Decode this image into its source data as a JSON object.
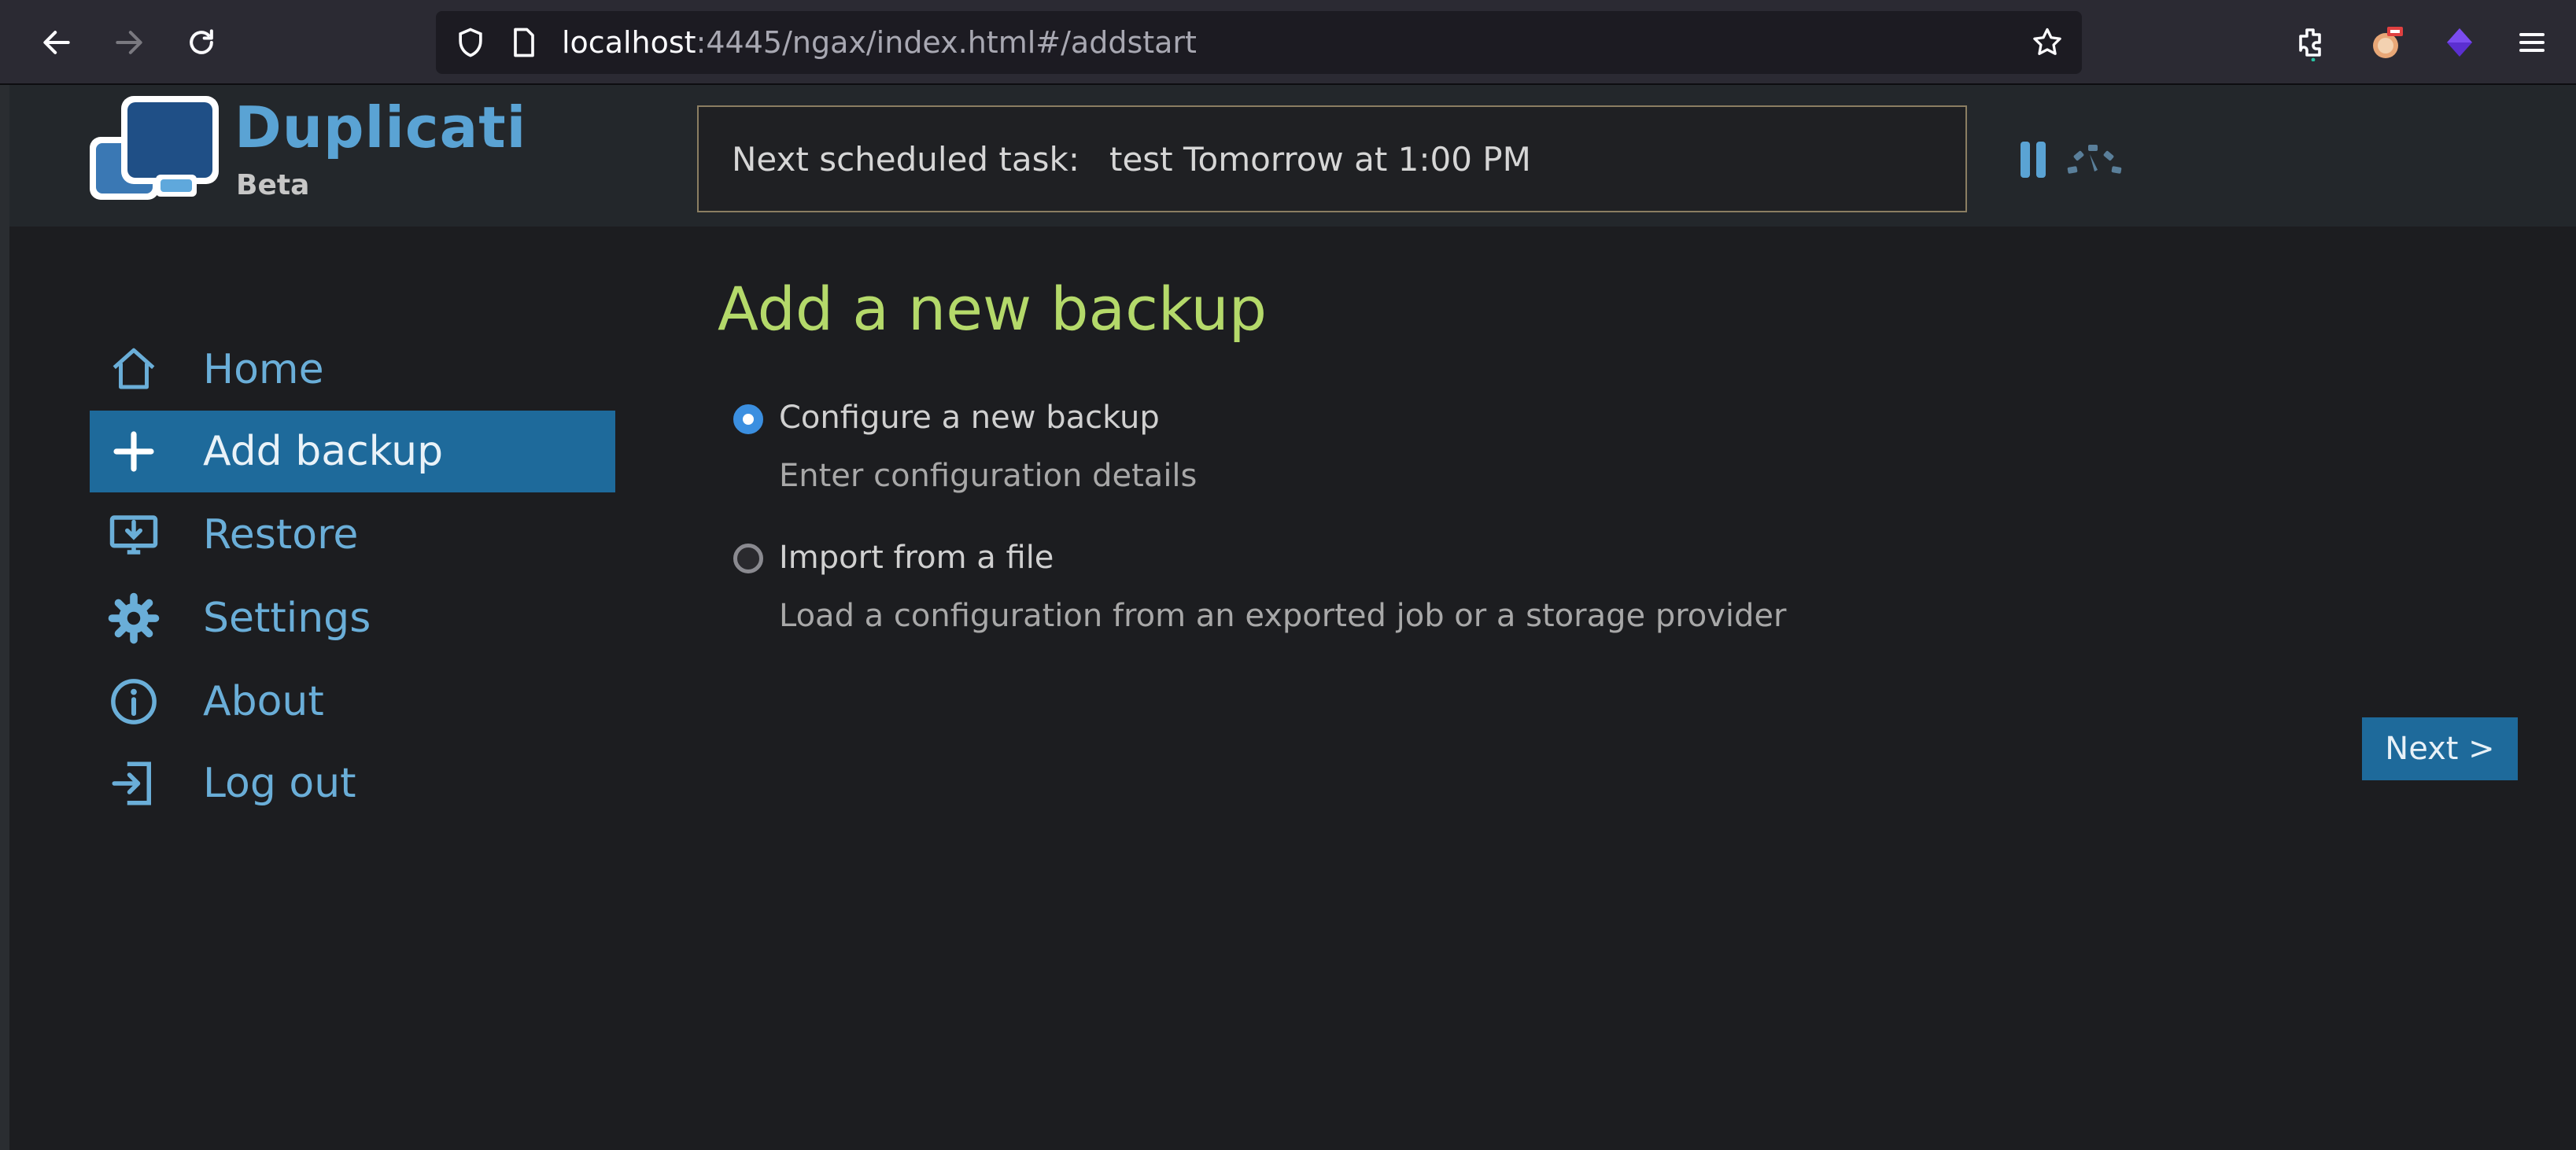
{
  "browser": {
    "url_host": "localhost",
    "url_path": ":4445/ngax/index.html#/addstart",
    "icons": [
      "back-icon",
      "forward-icon",
      "reload-icon",
      "shield-icon",
      "page-icon",
      "star-icon",
      "extensions-icon",
      "extension-avatar-icon",
      "extension-purple-icon",
      "menu-icon"
    ]
  },
  "header": {
    "app_name": "Duplicati",
    "app_tag": "Beta",
    "scheduled_label": "Next scheduled task:",
    "scheduled_value": "test Tomorrow at 1:00 PM"
  },
  "sidebar": {
    "items": [
      {
        "label": "Home",
        "icon": "home-icon"
      },
      {
        "label": "Add backup",
        "icon": "plus-icon",
        "active": true
      },
      {
        "label": "Restore",
        "icon": "restore-icon"
      },
      {
        "label": "Settings",
        "icon": "gear-icon"
      },
      {
        "label": "About",
        "icon": "info-icon"
      },
      {
        "label": "Log out",
        "icon": "logout-icon"
      }
    ]
  },
  "main": {
    "title": "Add a new backup",
    "options": [
      {
        "label": "Configure a new backup",
        "description": "Enter configuration details",
        "selected": true
      },
      {
        "label": "Import from a file",
        "description": "Load a configuration from an exported job or a storage provider",
        "selected": false
      }
    ],
    "next_label": "Next >"
  },
  "colors": {
    "accent": "#1e6a9b",
    "title_green": "#b4d96a",
    "link_blue": "#6aaed8",
    "background": "#1c1d20"
  }
}
